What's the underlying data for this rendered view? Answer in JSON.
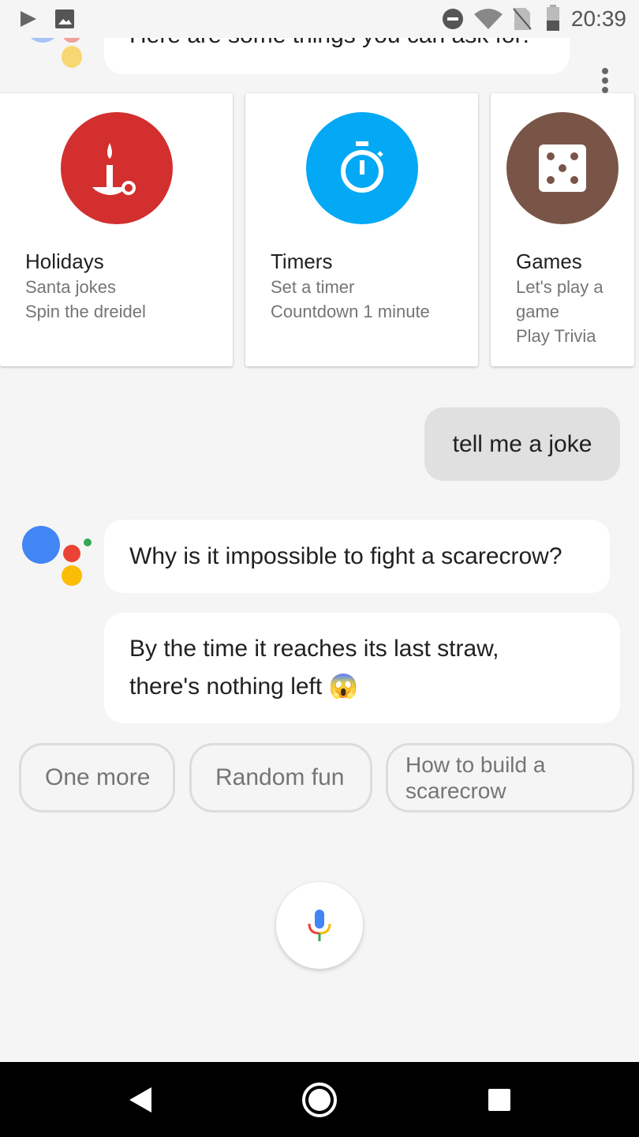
{
  "status_bar": {
    "time": "20:39"
  },
  "top_message": "Here are some things you can ask for:",
  "cards": [
    {
      "title": "Holidays",
      "lines": [
        "Santa jokes",
        "Spin the dreidel"
      ],
      "color": "#d32f2f",
      "icon": "candle-icon"
    },
    {
      "title": "Timers",
      "lines": [
        "Set a timer",
        "Countdown 1 minute"
      ],
      "color": "#03a9f4",
      "icon": "stopwatch-icon"
    },
    {
      "title": "Games",
      "lines": [
        "Let's play a game",
        "Play Trivia"
      ],
      "color": "#795548",
      "icon": "dice-icon"
    }
  ],
  "user_message": "tell me a joke",
  "assistant_messages": [
    "Why is it impossible to fight a scarecrow?",
    "By the time it reaches its last straw,",
    "there's nothing left 😱"
  ],
  "chips": [
    "One more",
    "Random fun",
    "How to build a scarecrow"
  ]
}
